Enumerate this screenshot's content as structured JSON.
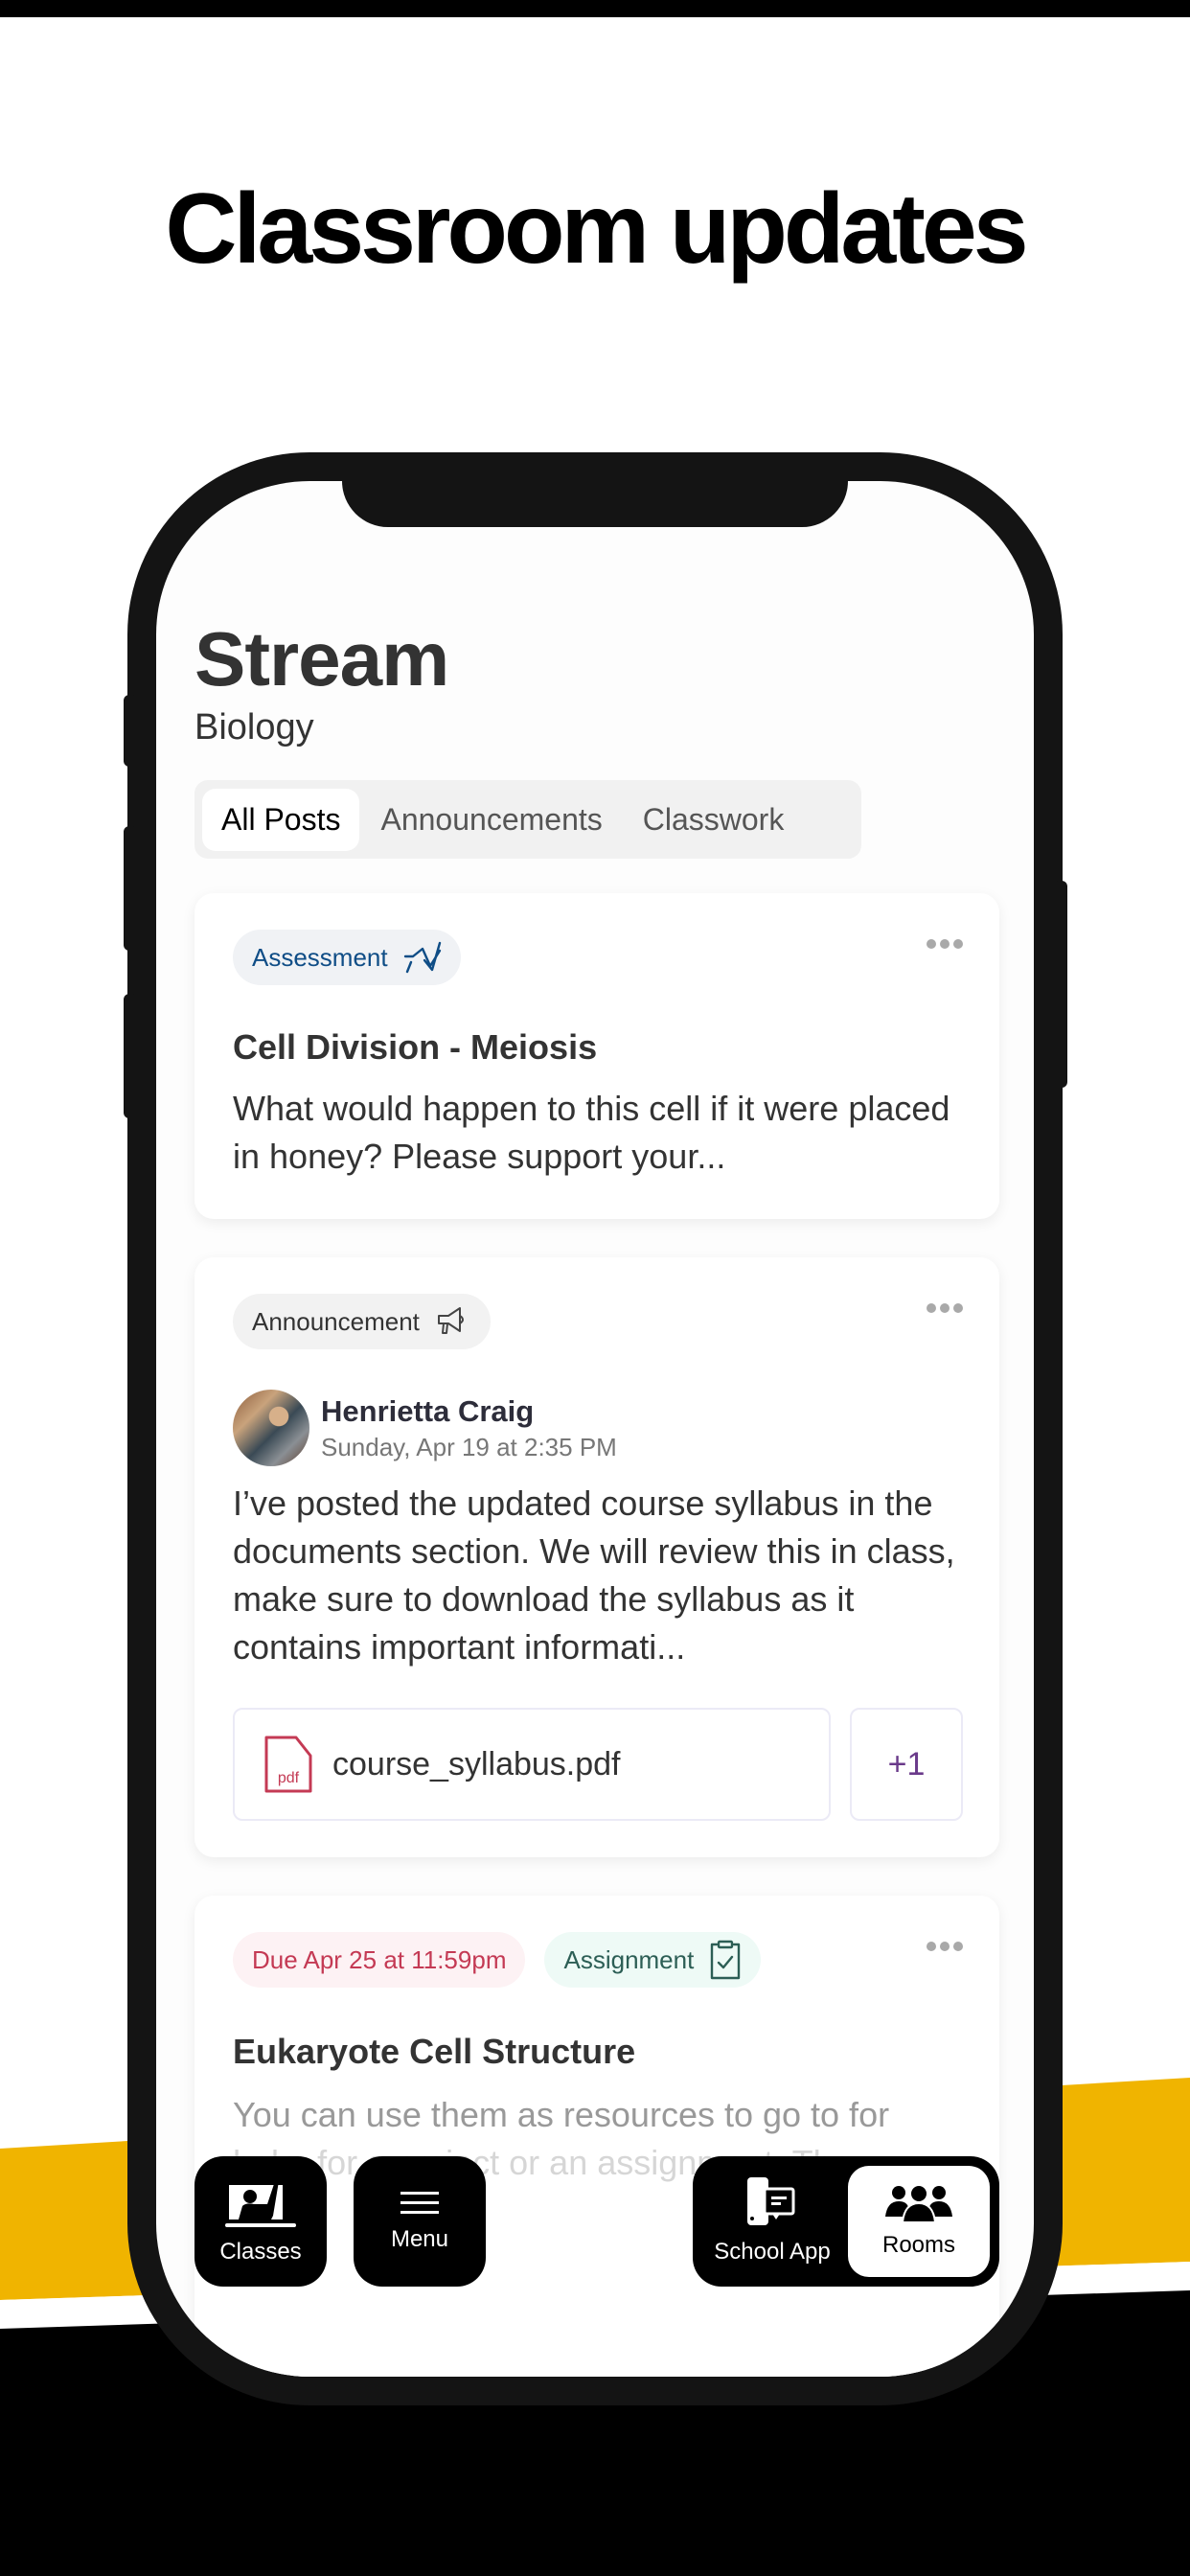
{
  "headline": "Classroom updates",
  "colors": {
    "accent_yellow": "#f0b400",
    "assessment_text": "#0f4d86",
    "assessment_bg": "#f0f2f5",
    "announcement_bg": "#f2f2f2",
    "due_text": "#c43a54",
    "due_bg": "#fdf2f4",
    "assignment_text": "#2c5e55",
    "assignment_bg": "#eefaf6",
    "pdf_red": "#c43a54",
    "attach_count": "#6a3a8a"
  },
  "screen": {
    "title": "Stream",
    "subtitle": "Biology",
    "tabs": [
      {
        "label": "All Posts",
        "active": true
      },
      {
        "label": "Announcements",
        "active": false
      },
      {
        "label": "Classwork",
        "active": false
      }
    ],
    "posts": [
      {
        "badge": {
          "label": "Assessment",
          "icon": "assessment-chart-icon"
        },
        "title": "Cell Division - Meiosis",
        "body": "What would happen to this cell if it were placed in honey? Please support your..."
      },
      {
        "badge": {
          "label": "Announcement",
          "icon": "megaphone-icon"
        },
        "author": "Henrietta Craig",
        "date": "Sunday, Apr 19 at 2:35 PM",
        "body": "I’ve posted the updated course syllabus in the documents section. We will review this in class, make sure to download the syllabus as it contains important informati...",
        "attachment": {
          "name": "course_syllabus.pdf",
          "type_label": "pdf",
          "more_count": "+1"
        }
      },
      {
        "due": "Due Apr 25 at 11:59pm",
        "badge": {
          "label": "Assignment",
          "icon": "clipboard-check-icon"
        },
        "title": "Eukaryote Cell Structure",
        "body_line1": "You can use them as resources to go to for",
        "body_line2": "help, for a project or an assignment. The"
      }
    ],
    "nav": {
      "classes": "Classes",
      "menu": "Menu",
      "school_app": "School App",
      "rooms": "Rooms",
      "active": "Rooms"
    }
  }
}
